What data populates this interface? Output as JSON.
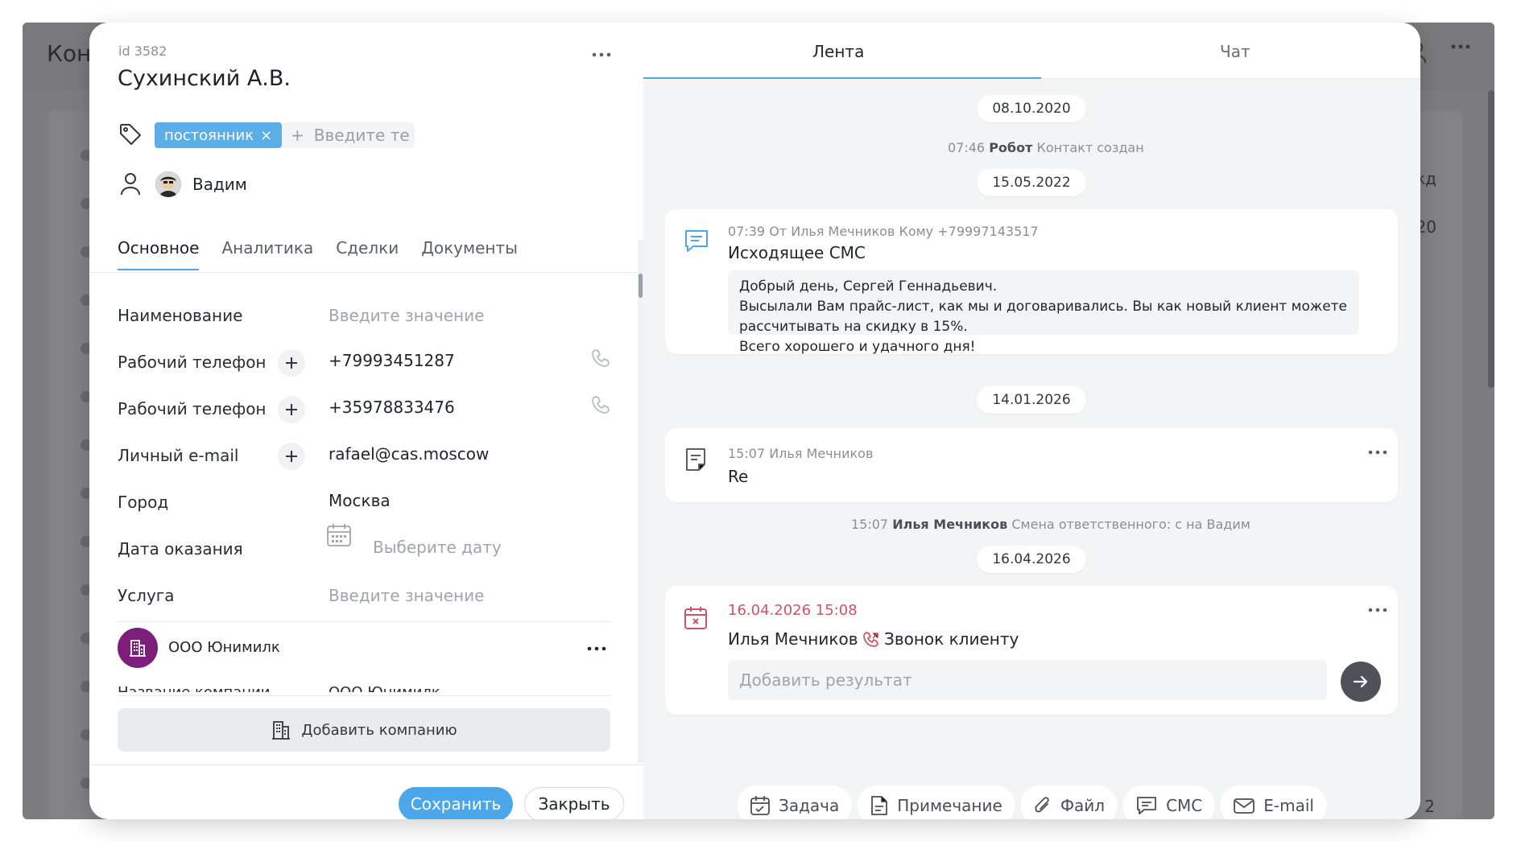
{
  "background": {
    "title_fragment": "Кон",
    "right_text_a": "кд",
    "right_text_b": "20",
    "right_text_c": "2"
  },
  "contact": {
    "id_label": "id 3582",
    "name": "Сухинский А.В.",
    "tag": "постоянник",
    "tag_remove": "×",
    "tag_input_placeholder": "Введите тег",
    "tag_add_symbol": "+",
    "owner": "Вадим"
  },
  "left_tabs": [
    {
      "label": "Основное",
      "active": true
    },
    {
      "label": "Аналитика",
      "active": false
    },
    {
      "label": "Сделки",
      "active": false
    },
    {
      "label": "Документы",
      "active": false
    }
  ],
  "fields": {
    "name": {
      "label": "Наименование",
      "placeholder": "Введите значение"
    },
    "phone1": {
      "label": "Рабочий телефон",
      "value": "+79993451287"
    },
    "phone2": {
      "label": "Рабочий телефон",
      "value": "+35978833476"
    },
    "email": {
      "label": "Личный e-mail",
      "value": "rafael@cas.moscow"
    },
    "city": {
      "label": "Город",
      "value": "Москва"
    },
    "service_date": {
      "label": "Дата оказания",
      "placeholder": "Выберите дату"
    },
    "service": {
      "label": "Услуга",
      "placeholder": "Введите значение"
    }
  },
  "company": {
    "name": "ООО Юнимилк",
    "field_label": "Название компании",
    "field_value": "ООО Юнимилк",
    "add_label": "Добавить компанию"
  },
  "footer": {
    "save": "Сохранить",
    "close": "Закрыть"
  },
  "right_tabs": {
    "feed": "Лента",
    "chat": "Чат"
  },
  "feed": {
    "date1": "08.10.2020",
    "sys1": {
      "time": "07:46",
      "who": "Робот",
      "text": "Контакт создан"
    },
    "date2": "15.05.2022",
    "sms": {
      "meta": "07:39 От Илья Мечников Кому +79997143517",
      "title": "Исходящее СМС",
      "lines": [
        "Добрый день, Сергей Геннадьевич.",
        "Высылали Вам прайс-лист, как мы и договаривались. Вы как новый клиент можете",
        "рассчитывать на скидку в 15%.",
        "Всего хорошего и удачного дня!"
      ]
    },
    "date3": "14.01.2026",
    "note": {
      "meta": "15:07 Илья Мечников",
      "title": "Re"
    },
    "sys2": {
      "time": "15:07",
      "who": "Илья Мечников",
      "text": "Смена ответственного: с на Вадим"
    },
    "date4": "16.04.2026",
    "task": {
      "datetime": "16.04.2026 15:08",
      "author": "Илья Мечников",
      "type": "Звонок клиенту",
      "result_placeholder": "Добавить результат"
    }
  },
  "actions": [
    {
      "label": "Задача",
      "icon": "calendar-check-icon"
    },
    {
      "label": "Примечание",
      "icon": "note-icon"
    },
    {
      "label": "Файл",
      "icon": "paperclip-icon"
    },
    {
      "label": "СМС",
      "icon": "chat-icon"
    },
    {
      "label": "E-mail",
      "icon": "mail-icon"
    }
  ],
  "colors": {
    "accent": "#4ba6ea",
    "tag_bg": "#5baee8",
    "task_date": "#d05363",
    "company_logo": "#7b1f7a"
  }
}
